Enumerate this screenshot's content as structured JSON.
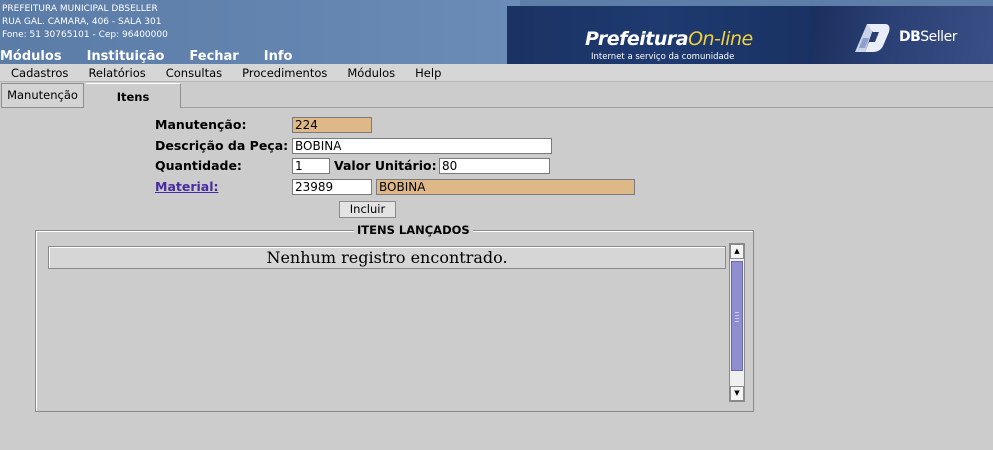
{
  "header": {
    "org_name": "PREFEITURA MUNICIPAL DBSELLER",
    "address": "RUA GAL. CAMARA, 406 - SALA 301",
    "contact": "Fone: 51 30765101  -  Cep: 96400000",
    "top_menu": [
      "Módulos",
      "Instituição",
      "Fechar",
      "Info"
    ],
    "brand_main": "Prefeitura",
    "brand_accent": "On-line",
    "brand_tagline": "Internet a serviço da comunidade",
    "company_logo_bold": "DB",
    "company_logo_rest": "Seller"
  },
  "menubar": [
    "Cadastros",
    "Relatórios",
    "Consultas",
    "Procedimentos",
    "Módulos",
    "Help"
  ],
  "tabs": [
    {
      "label": "Manutenção",
      "active": false
    },
    {
      "label": "Itens",
      "active": true
    }
  ],
  "form": {
    "manutencao_label": "Manutenção:",
    "manutencao_value": "224",
    "descricao_label": "Descrição da Peça:",
    "descricao_value": "BOBINA",
    "quantidade_label": "Quantidade:",
    "quantidade_value": "1",
    "valor_label": "Valor Unitário:",
    "valor_value": "80",
    "material_label": "Material:",
    "material_code": "23989",
    "material_desc": "BOBINA",
    "incluir_label": "Incluir"
  },
  "items": {
    "legend": "ITENS LANÇADOS",
    "empty_message": "Nenhum registro encontrado.",
    "scroll_up": "▲",
    "scroll_down": "▼"
  },
  "colors": {
    "readonly_field": "#deb887",
    "banner": "#5d7ea8",
    "scroll_thumb": "#8f8fcf"
  }
}
